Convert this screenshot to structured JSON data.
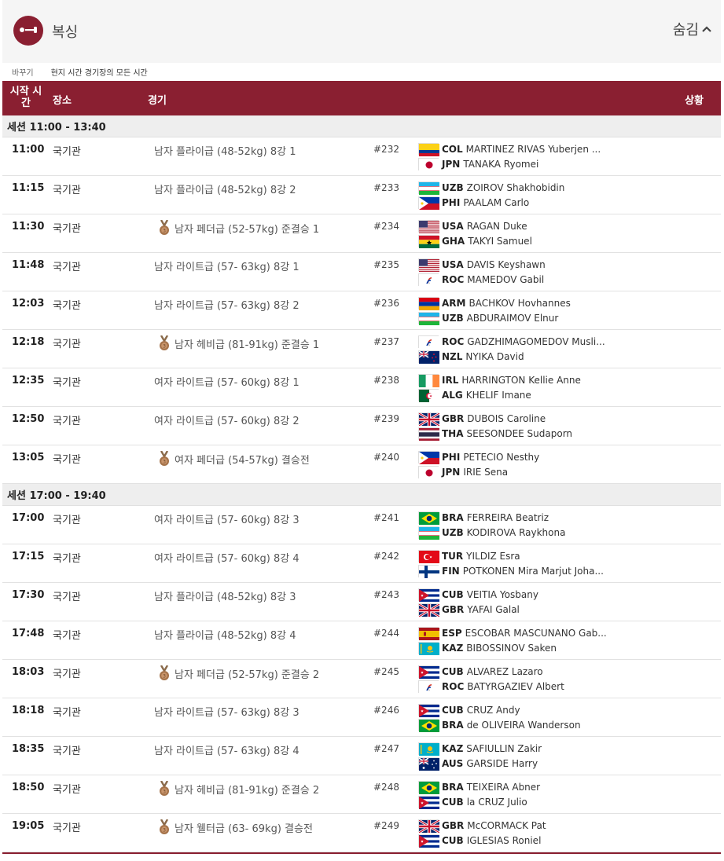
{
  "header": {
    "sport": "복싱",
    "hide_label": "숨김"
  },
  "timezone": {
    "change": "바꾸기",
    "note": "현지 시간 경기장의 모든 시간"
  },
  "columns": {
    "time": "시작 시간",
    "venue": "장소",
    "event": "경기",
    "status": "상황"
  },
  "colors": {
    "accent": "#8a1f31"
  },
  "sessions": [
    {
      "label": "세션  11:00 - 13:40",
      "matches": [
        {
          "time": "11:00",
          "venue": "국기관",
          "event": "남자 플라이급 (48-52kg) 8강 1",
          "medal": false,
          "num": "#232",
          "a": {
            "code": "COL",
            "name": "MARTINEZ RIVAS Yuberjen ...",
            "flag": "col"
          },
          "b": {
            "code": "JPN",
            "name": "TANAKA Ryomei",
            "flag": "jpn"
          }
        },
        {
          "time": "11:15",
          "venue": "국기관",
          "event": "남자 플라이급 (48-52kg) 8강 2",
          "medal": false,
          "num": "#233",
          "a": {
            "code": "UZB",
            "name": "ZOIROV Shakhobidin",
            "flag": "uzb"
          },
          "b": {
            "code": "PHI",
            "name": "PAALAM Carlo",
            "flag": "phi"
          }
        },
        {
          "time": "11:30",
          "venue": "국기관",
          "event": "남자 페더급 (52-57kg) 준결승 1",
          "medal": true,
          "num": "#234",
          "a": {
            "code": "USA",
            "name": "RAGAN Duke",
            "flag": "usa"
          },
          "b": {
            "code": "GHA",
            "name": "TAKYI Samuel",
            "flag": "gha"
          }
        },
        {
          "time": "11:48",
          "venue": "국기관",
          "event": "남자 라이트급 (57- 63kg) 8강 1",
          "medal": false,
          "num": "#235",
          "a": {
            "code": "USA",
            "name": "DAVIS Keyshawn",
            "flag": "usa"
          },
          "b": {
            "code": "ROC",
            "name": "MAMEDOV Gabil",
            "flag": "roc"
          }
        },
        {
          "time": "12:03",
          "venue": "국기관",
          "event": "남자 라이트급 (57- 63kg) 8강 2",
          "medal": false,
          "num": "#236",
          "a": {
            "code": "ARM",
            "name": "BACHKOV Hovhannes",
            "flag": "arm"
          },
          "b": {
            "code": "UZB",
            "name": "ABDURAIMOV Elnur",
            "flag": "uzb"
          }
        },
        {
          "time": "12:18",
          "venue": "국기관",
          "event": "남자 헤비급 (81-91kg) 준결승 1",
          "medal": true,
          "num": "#237",
          "a": {
            "code": "ROC",
            "name": "GADZHIMAGOMEDOV Musli...",
            "flag": "roc"
          },
          "b": {
            "code": "NZL",
            "name": "NYIKA David",
            "flag": "nzl"
          }
        },
        {
          "time": "12:35",
          "venue": "국기관",
          "event": "여자 라이트급 (57- 60kg) 8강 1",
          "medal": false,
          "num": "#238",
          "a": {
            "code": "IRL",
            "name": "HARRINGTON Kellie Anne",
            "flag": "irl"
          },
          "b": {
            "code": "ALG",
            "name": "KHELIF Imane",
            "flag": "alg"
          }
        },
        {
          "time": "12:50",
          "venue": "국기관",
          "event": "여자 라이트급 (57- 60kg) 8강 2",
          "medal": false,
          "num": "#239",
          "a": {
            "code": "GBR",
            "name": "DUBOIS Caroline",
            "flag": "gbr"
          },
          "b": {
            "code": "THA",
            "name": "SEESONDEE Sudaporn",
            "flag": "tha"
          }
        },
        {
          "time": "13:05",
          "venue": "국기관",
          "event": "여자 페더급 (54-57kg) 결승전",
          "medal": true,
          "num": "#240",
          "a": {
            "code": "PHI",
            "name": "PETECIO Nesthy",
            "flag": "phi"
          },
          "b": {
            "code": "JPN",
            "name": "IRIE Sena",
            "flag": "jpn"
          }
        }
      ]
    },
    {
      "label": "세션  17:00 - 19:40",
      "matches": [
        {
          "time": "17:00",
          "venue": "국기관",
          "event": "여자 라이트급 (57- 60kg) 8강 3",
          "medal": false,
          "num": "#241",
          "a": {
            "code": "BRA",
            "name": "FERREIRA Beatriz",
            "flag": "bra"
          },
          "b": {
            "code": "UZB",
            "name": "KODIROVA Raykhona",
            "flag": "uzb"
          }
        },
        {
          "time": "17:15",
          "venue": "국기관",
          "event": "여자 라이트급 (57- 60kg) 8강 4",
          "medal": false,
          "num": "#242",
          "a": {
            "code": "TUR",
            "name": "YILDIZ Esra",
            "flag": "tur"
          },
          "b": {
            "code": "FIN",
            "name": "POTKONEN Mira Marjut Joha...",
            "flag": "fin"
          }
        },
        {
          "time": "17:30",
          "venue": "국기관",
          "event": "남자 플라이급 (48-52kg) 8강 3",
          "medal": false,
          "num": "#243",
          "a": {
            "code": "CUB",
            "name": "VEITIA Yosbany",
            "flag": "cub"
          },
          "b": {
            "code": "GBR",
            "name": "YAFAI Galal",
            "flag": "gbr"
          }
        },
        {
          "time": "17:48",
          "venue": "국기관",
          "event": "남자 플라이급 (48-52kg) 8강 4",
          "medal": false,
          "num": "#244",
          "a": {
            "code": "ESP",
            "name": "ESCOBAR MASCUNANO Gab...",
            "flag": "esp"
          },
          "b": {
            "code": "KAZ",
            "name": "BIBOSSINOV Saken",
            "flag": "kaz"
          }
        },
        {
          "time": "18:03",
          "venue": "국기관",
          "event": "남자 페더급 (52-57kg) 준결승 2",
          "medal": true,
          "num": "#245",
          "a": {
            "code": "CUB",
            "name": "ALVAREZ Lazaro",
            "flag": "cub"
          },
          "b": {
            "code": "ROC",
            "name": "BATYRGAZIEV Albert",
            "flag": "roc"
          }
        },
        {
          "time": "18:18",
          "venue": "국기관",
          "event": "남자 라이트급 (57- 63kg) 8강 3",
          "medal": false,
          "num": "#246",
          "a": {
            "code": "CUB",
            "name": "CRUZ Andy",
            "flag": "cub"
          },
          "b": {
            "code": "BRA",
            "name": "de OLIVEIRA Wanderson",
            "flag": "bra"
          }
        },
        {
          "time": "18:35",
          "venue": "국기관",
          "event": "남자 라이트급 (57- 63kg) 8강 4",
          "medal": false,
          "num": "#247",
          "a": {
            "code": "KAZ",
            "name": "SAFIULLIN Zakir",
            "flag": "kaz"
          },
          "b": {
            "code": "AUS",
            "name": "GARSIDE Harry",
            "flag": "aus"
          }
        },
        {
          "time": "18:50",
          "venue": "국기관",
          "event": "남자 헤비급 (81-91kg) 준결승 2",
          "medal": true,
          "num": "#248",
          "a": {
            "code": "BRA",
            "name": "TEIXEIRA Abner",
            "flag": "bra"
          },
          "b": {
            "code": "CUB",
            "name": "la CRUZ Julio",
            "flag": "cub"
          }
        },
        {
          "time": "19:05",
          "venue": "국기관",
          "event": "남자 웰터급 (63- 69kg) 결승전",
          "medal": true,
          "num": "#249",
          "a": {
            "code": "GBR",
            "name": "McCORMACK Pat",
            "flag": "gbr"
          },
          "b": {
            "code": "CUB",
            "name": "IGLESIAS Roniel",
            "flag": "cub"
          }
        }
      ]
    }
  ]
}
